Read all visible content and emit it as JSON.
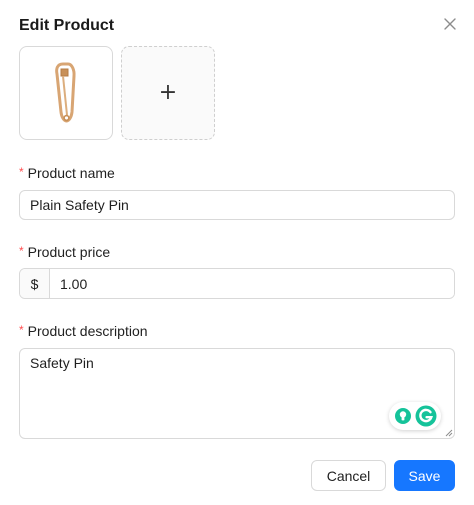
{
  "modal": {
    "title": "Edit Product"
  },
  "images": {
    "upload_symbol": "+",
    "product_image_icon": "safety-pin-icon"
  },
  "fields": {
    "name": {
      "required_mark": "*",
      "label": "Product name",
      "value": "Plain Safety Pin"
    },
    "price": {
      "required_mark": "*",
      "label": "Product price",
      "currency": "$",
      "value": "1.00"
    },
    "description": {
      "required_mark": "*",
      "label": "Product description",
      "value": "Safety Pin"
    }
  },
  "footer": {
    "cancel_label": "Cancel",
    "save_label": "Save"
  },
  "colors": {
    "primary": "#1677ff",
    "required": "#ff4d4f",
    "border": "#d9d9d9",
    "grammarly_green": "#15c39a"
  }
}
